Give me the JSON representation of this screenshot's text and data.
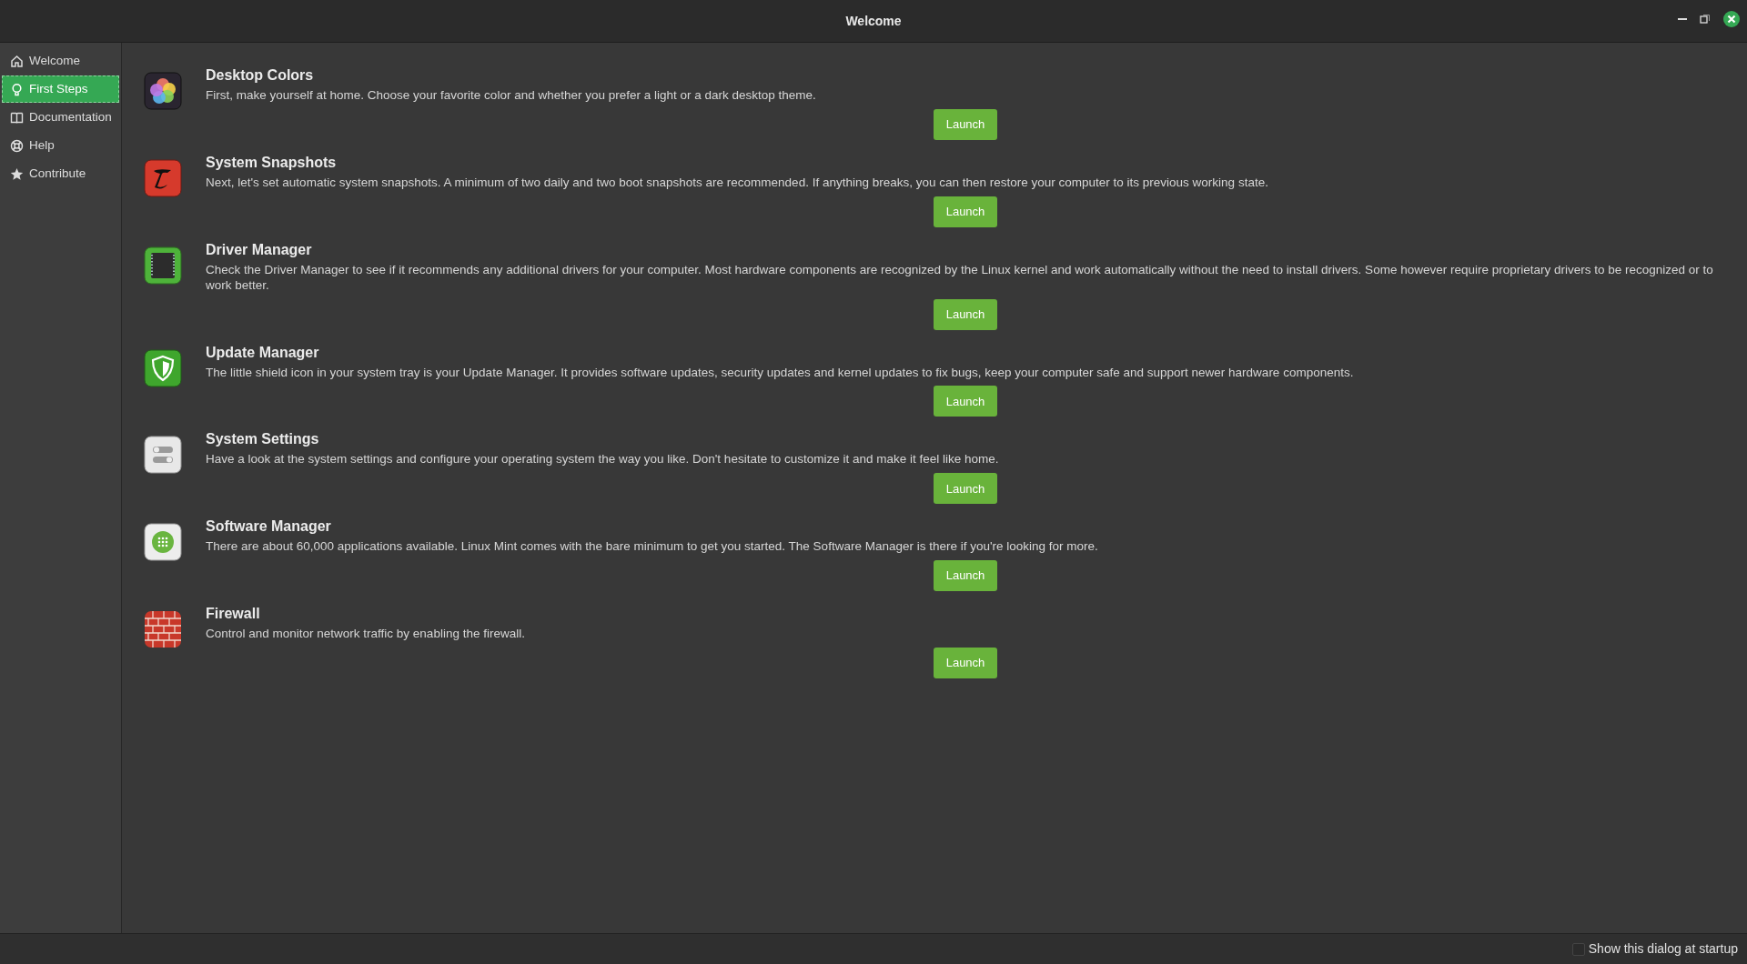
{
  "window": {
    "title": "Welcome"
  },
  "sidebar": {
    "items": [
      {
        "label": "Welcome",
        "selected": false
      },
      {
        "label": "First Steps",
        "selected": true
      },
      {
        "label": "Documentation",
        "selected": false
      },
      {
        "label": "Help",
        "selected": false
      },
      {
        "label": "Contribute",
        "selected": false
      }
    ]
  },
  "steps": [
    {
      "title": "Desktop Colors",
      "description": "First, make yourself at home. Choose your favorite color and whether you prefer a light or a dark desktop theme.",
      "button": "Launch"
    },
    {
      "title": "System Snapshots",
      "description": "Next, let's set automatic system snapshots. A minimum of two daily and two boot snapshots are recommended. If anything breaks, you can then restore your computer to its previous working state.",
      "button": "Launch"
    },
    {
      "title": "Driver Manager",
      "description": "Check the Driver Manager to see if it recommends any additional drivers for your computer. Most hardware components are recognized by the Linux kernel and work automatically without the need to install drivers. Some however require proprietary drivers to be recognized or to work better.",
      "button": "Launch"
    },
    {
      "title": "Update Manager",
      "description": "The little shield icon in your system tray is your Update Manager. It provides software updates, security updates and kernel updates to fix bugs, keep your computer safe and support newer hardware components.",
      "button": "Launch"
    },
    {
      "title": "System Settings",
      "description": "Have a look at the system settings and configure your operating system the way you like. Don't hesitate to customize it and make it feel like home.",
      "button": "Launch"
    },
    {
      "title": "Software Manager",
      "description": "There are about 60,000 applications available. Linux Mint comes with the bare minimum to get you started. The Software Manager is there if you're looking for more.",
      "button": "Launch"
    },
    {
      "title": "Firewall",
      "description": "Control and monitor network traffic by enabling the firewall.",
      "button": "Launch"
    }
  ],
  "footer": {
    "checkbox": {
      "label": "Show this dialog at startup",
      "checked": false
    }
  }
}
